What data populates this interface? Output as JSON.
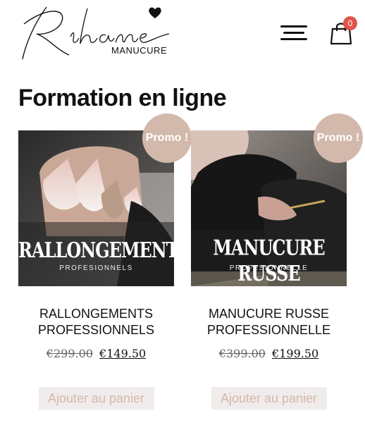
{
  "header": {
    "logo_text": "Rihanne",
    "logo_subtitle": "MANUCURE",
    "icons": [
      "heart-icon",
      "menu-icon",
      "cart-icon"
    ],
    "cart_count": "0"
  },
  "page": {
    "title": "Formation en ligne"
  },
  "products": [
    {
      "badge": "Promo !",
      "image_title": "RALLONGEMENTS",
      "image_subtitle": "PROFESIONNELS",
      "name_line1": "RALLONGEMENTS",
      "name_line2": "PROFESSIONNELS",
      "old_price": "€299.00",
      "new_price": "€149.50",
      "button_label": "Ajouter au panier"
    },
    {
      "badge": "Promo !",
      "image_title": "MANUCURE RUSSE",
      "image_subtitle": "PROFESIONNELLE",
      "name_line1": "MANUCURE RUSSE",
      "name_line2": "PROFESSIONNELLE",
      "old_price": "€399.00",
      "new_price": "€199.50",
      "button_label": "Ajouter au panier"
    }
  ],
  "colors": {
    "promo_badge": "#d2b9ab",
    "cart_badge": "#e0544b",
    "button_bg": "#f1ecec",
    "button_text": "#d2b9ab"
  }
}
